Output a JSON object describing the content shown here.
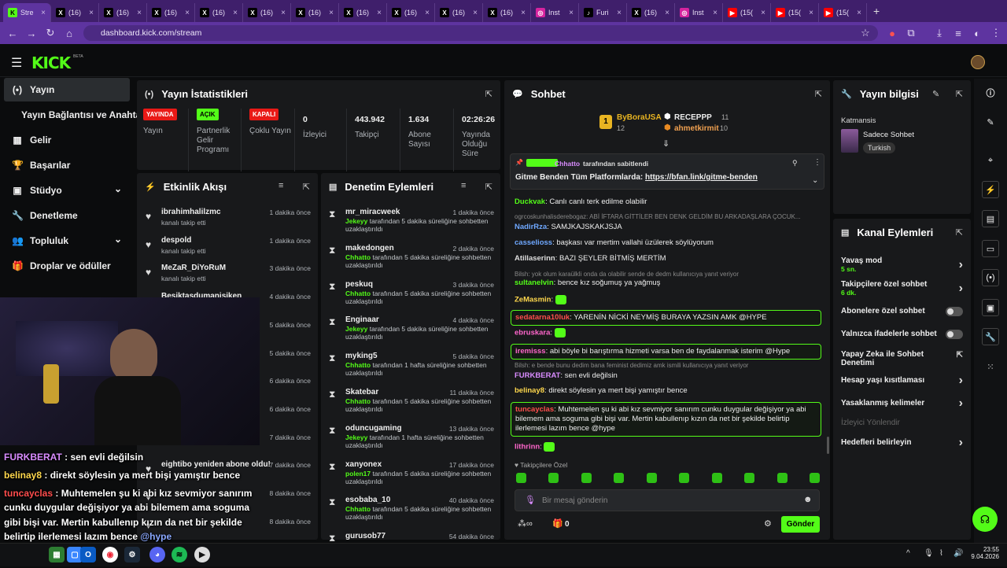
{
  "browser": {
    "tabs": [
      {
        "label": "Stre",
        "icon": "K",
        "color": "#53fc18",
        "active": true
      },
      {
        "label": "(16)",
        "icon": "X",
        "color": "#000"
      },
      {
        "label": "(16)",
        "icon": "X",
        "color": "#000"
      },
      {
        "label": "(16)",
        "icon": "X",
        "color": "#000"
      },
      {
        "label": "(16)",
        "icon": "X",
        "color": "#000"
      },
      {
        "label": "(16)",
        "icon": "X",
        "color": "#000"
      },
      {
        "label": "(16)",
        "icon": "X",
        "color": "#000"
      },
      {
        "label": "(16)",
        "icon": "X",
        "color": "#000"
      },
      {
        "label": "(16)",
        "icon": "X",
        "color": "#000"
      },
      {
        "label": "(16)",
        "icon": "X",
        "color": "#000"
      },
      {
        "label": "(16)",
        "icon": "X",
        "color": "#000"
      },
      {
        "label": "Inst",
        "icon": "◎",
        "color": "#d6249f"
      },
      {
        "label": "Furi",
        "icon": "♪",
        "color": "#000"
      },
      {
        "label": "(16)",
        "icon": "X",
        "color": "#000"
      },
      {
        "label": "Inst",
        "icon": "◎",
        "color": "#d6249f"
      },
      {
        "label": "(15(",
        "icon": "▶",
        "color": "#ff0000"
      },
      {
        "label": "(15(",
        "icon": "▶",
        "color": "#ff0000"
      },
      {
        "label": "(15(",
        "icon": "▶",
        "color": "#ff0000"
      }
    ],
    "url": "dashboard.kick.com/stream"
  },
  "app": {
    "logo": "KICK",
    "beta": "BETA"
  },
  "sidebar": [
    {
      "label": "Yayın",
      "icon": "(•)",
      "active": true
    },
    {
      "label": "Yayın Bağlantısı ve Anahtarı",
      "icon": ""
    },
    {
      "label": "Gelir",
      "icon": "▦"
    },
    {
      "label": "Başarılar",
      "icon": "🏆"
    },
    {
      "label": "Stüdyo",
      "icon": "▣",
      "chev": true
    },
    {
      "label": "Denetleme",
      "icon": "🔧"
    },
    {
      "label": "Topluluk",
      "icon": "👥",
      "chev": true
    },
    {
      "label": "Droplar ve ödüller",
      "icon": "🎁"
    }
  ],
  "stats": {
    "title": "Yayın İstatistikleri",
    "items": [
      {
        "badge": "YAYINDA",
        "badge_color": "#e91916",
        "label": "Yayın"
      },
      {
        "badge": "AÇIK",
        "badge_color": "#53fc18",
        "label": "Partnerlik Gelir Programı"
      },
      {
        "badge": "KAPALI",
        "badge_color": "#e91916",
        "label": "Çoklu Yayın"
      },
      {
        "value": "0",
        "label": "İzleyici"
      },
      {
        "value": "443.942",
        "label": "Takipçi"
      },
      {
        "value": "1.634",
        "label": "Abone Sayısı"
      },
      {
        "value": "02:26:26",
        "label": "Yayında Olduğu Süre"
      }
    ]
  },
  "feed": {
    "title": "Etkinlik Akışı",
    "items": [
      {
        "name": "ibrahimhalilzmc",
        "sub": "kanalı takip etti",
        "time": "1 dakika önce"
      },
      {
        "name": "despold",
        "sub": "kanalı takip etti",
        "time": "1 dakika önce"
      },
      {
        "name": "MeZaR_DiYoRuM",
        "sub": "kanalı takip etti",
        "time": "3 dakika önce"
      },
      {
        "name": "Besiktasdumanisiken",
        "sub": "",
        "time": "4 dakika önce"
      },
      {
        "name": "",
        "sub": "",
        "time": "5 dakika önce"
      },
      {
        "name": "",
        "sub": "",
        "time": "5 dakika önce"
      },
      {
        "name": "!",
        "sub": "",
        "time": "6 dakika önce"
      },
      {
        "name": "",
        "sub": "",
        "time": "6 dakika önce"
      },
      {
        "name": "",
        "sub": "",
        "time": "7 dakika önce"
      },
      {
        "name": "eightibo yeniden abone oldu!",
        "sub": "",
        "time": "7 dakika önce"
      },
      {
        "name": "",
        "sub": "",
        "time": "8 dakika önce"
      },
      {
        "name": "",
        "sub": "",
        "time": "8 dakika önce"
      }
    ]
  },
  "moderation": {
    "title": "Denetim Eylemleri",
    "items": [
      {
        "name": "mr_miracweek",
        "mod": "Jekeyy",
        "action": "tarafından 5 dakika süreliğine sohbetten uzaklaştırıldı",
        "time": "1 dakika önce"
      },
      {
        "name": "makedongen",
        "mod": "Chhatto",
        "action": "tarafından 5 dakika süreliğine sohbetten uzaklaştırıldı",
        "time": "2 dakika önce"
      },
      {
        "name": "peskuq",
        "mod": "Chhatto",
        "action": "tarafından 5 dakika süreliğine sohbetten uzaklaştırıldı",
        "time": "3 dakika önce"
      },
      {
        "name": "Enginaar",
        "mod": "Jekeyy",
        "action": "tarafından 5 dakika süreliğine sohbetten uzaklaştırıldı",
        "time": "4 dakika önce"
      },
      {
        "name": "myking5",
        "mod": "Chhatto",
        "action": "tarafından 1 hafta süreliğine sohbetten uzaklaştırıldı",
        "time": "5 dakika önce"
      },
      {
        "name": "Skatebar",
        "mod": "Chhatto",
        "action": "tarafından 5 dakika süreliğine sohbetten uzaklaştırıldı",
        "time": "11 dakika önce"
      },
      {
        "name": "oduncugaming",
        "mod": "Jekeyy",
        "action": "tarafından 1 hafta süreliğine sohbetten uzaklaştırıldı",
        "time": "13 dakika önce"
      },
      {
        "name": "xanyonex",
        "mod": "polen17",
        "action": "tarafından 5 dakika süreliğine sohbetten uzaklaştırıldı",
        "time": "17 dakika önce"
      },
      {
        "name": "esobaba_10",
        "mod": "Chhatto",
        "action": "tarafından 5 dakika süreliğine sohbetten uzaklaştırıldı",
        "time": "40 dakika önce"
      },
      {
        "name": "gurusob77",
        "mod": "",
        "action": "",
        "time": "54 dakika önce"
      }
    ]
  },
  "chat": {
    "title": "Sohbet",
    "leaderboard": [
      {
        "rank": "1",
        "name": "ByBoraUSA",
        "count": "12"
      },
      {
        "name": "RECEPPP",
        "count": "11"
      },
      {
        "name": "ahmetkirmit",
        "count": "10"
      }
    ],
    "pinned": {
      "by": "Chhatto",
      "by_text": "tarafından sabitlendi",
      "text": "Gitme Benden Tüm Platformlarda: ",
      "link": "https://bfan.link/gitme-benden"
    },
    "messages": [
      {
        "user": "Duckvak",
        "color": "#53fc18",
        "text": "Canlı canlı terk edilme olabilir"
      },
      {
        "reply": "ogrcoskunhalisderebogaz: ABİ İFTARA GİTTİLER BEN DENK GELDİM BU ARKADAŞLARA ÇOCUK..."
      },
      {
        "user": "NadirRza",
        "color": "#6fa8ff",
        "text": "SAMJKAJSKAKJSJA"
      },
      {
        "user": "casselioss",
        "color": "#6fa8ff",
        "text": "başkası var mertim vallahi üzülerek söylüyorum"
      },
      {
        "user": "Atillaserinn",
        "color": "#ddd",
        "text": "BAZI ŞEYLER BİTMİŞ MERTİM"
      },
      {
        "reply": "Bilsh: yok olum karaülkli onda da olabilir sende de dedm kullanıcıya yanıt veriyor"
      },
      {
        "user": "sultanelvin",
        "color": "#53fc18",
        "text": "bence kız soğumuş ya yağmuş"
      },
      {
        "user": "ZeMasmin",
        "color": "#ffd84d",
        "text": ""
      },
      {
        "user": "sedatarna10luk",
        "color": "#ff4d4d",
        "text": "YARENİN NİCKİ NEYMİŞ BURAYA YAZSIN AMK @HYPE",
        "hl": true
      },
      {
        "user": "ebruskara",
        "color": "#ff66cc",
        "text": ""
      },
      {
        "user": "iremisss",
        "color": "#ff66cc",
        "text": "abi böyle bi barıştırma hizmeti varsa ben de faydalanmak isterim @Hype",
        "hl": true
      },
      {
        "reply": "Bilsh: e bende bunu dedim bana feminist dedimiz amk ismili kullanıcıya yanıt veriyor"
      },
      {
        "user": "FURKBERAT",
        "color": "#d98cff",
        "text": "sen evli değilsin"
      },
      {
        "user": "belinay8",
        "color": "#ffd84d",
        "text": "direkt söylesin ya mert bişi yamıştır bence"
      },
      {
        "user": "tuncayclas",
        "color": "#ff4d4d",
        "text": "Muhtemelen şu ki abi kız sevmiyor sanırım cunku duygular değişiyor ya abi bilemem ama soguma gibi bişi var. Mertin kabullenıp kızın da net bir şekilde belirtip ilerlemesi lazım bence @hype",
        "hl": true
      },
      {
        "user": "lithrinn",
        "color": "#ff66cc",
        "text": ""
      }
    ],
    "followers_only": "Takipçilere Özel",
    "input_placeholder": "Bir mesaj gönderin",
    "send": "Gönder",
    "count": "0"
  },
  "info": {
    "title": "Yayın bilgisi",
    "category": "Katmansis",
    "mode": "Sadece Sohbet",
    "lang": "Turkish"
  },
  "actions": {
    "title": "Kanal Eylemleri",
    "items": [
      {
        "label": "Yavaş mod",
        "sub": "5 sn.",
        "type": "chev"
      },
      {
        "label": "Takipçilere özel sohbet",
        "sub": "6 dk.",
        "type": "chev"
      },
      {
        "label": "Abonelere özel sohbet",
        "type": "toggle"
      },
      {
        "label": "Yalnızca ifadelerle sohbet",
        "type": "toggle"
      },
      {
        "label": "Yapay Zeka ile Sohbet Denetimi",
        "type": "ext"
      },
      {
        "label": "Hesap yaşı kısıtlaması",
        "type": "chev"
      },
      {
        "label": "Yasaklanmış kelimeler",
        "type": "chev"
      },
      {
        "label": "İzleyici Yönlendir",
        "type": "dim"
      },
      {
        "label": "Hedefleri belirleyin",
        "type": "chev"
      }
    ]
  },
  "overlay": [
    {
      "user": "FURKBERAT",
      "color": "#d98cff",
      "text": " : sen evli değilsin"
    },
    {
      "user": "belinay8",
      "color": "#ffd84d",
      "text": " : direkt söylesin ya mert bişi yamıştır bence"
    },
    {
      "user": "tuncayclas",
      "color": "#ff4d4d",
      "text": " : Muhtemelen şu ki abi kız sevmiyor sanırım"
    },
    {
      "text": "cunku duygular değişiyor ya abi bilemem ama soguma"
    },
    {
      "text": "gibi bişi var. Mertin kabullenıp kızın da net bir şekilde"
    },
    {
      "text": "belirtip ilerlemesi lazım bence ",
      "mention": "@hype"
    },
    {
      "user": "lithrinn",
      "color": "#ff66cc",
      "text": " :"
    }
  ],
  "taskbar": {
    "time": "23:55",
    "date": "9.04.2026"
  }
}
